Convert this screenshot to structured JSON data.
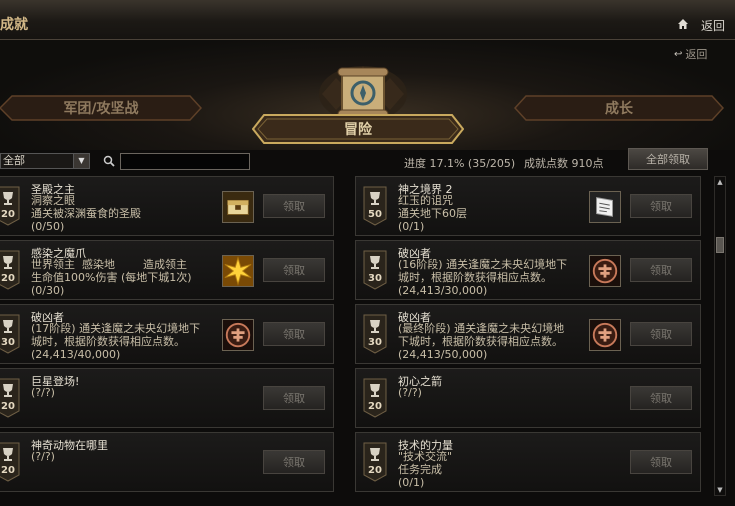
{
  "window": {
    "title": "成就",
    "back_top": "返回",
    "back_sub": "返回"
  },
  "tabs": {
    "left": "军团/攻坚战",
    "active": "冒险",
    "right": "成长"
  },
  "toolbar": {
    "filter_value": "全部",
    "search_value": "",
    "progress": "进度  17.1% (35/205)",
    "points": "成就点数 910点",
    "claim_all": "全部领取"
  },
  "achievements": [
    {
      "name": "圣殿之主",
      "desc": "洞察之眼\n通关被深渊蚕食的圣殿\n(0/50)",
      "points": "20",
      "reward": "chest-icon"
    },
    {
      "name": "神之境界 2",
      "desc": "红玉的诅咒\n通关地下60层\n(0/1)",
      "points": "50",
      "reward": "scroll-icon"
    },
    {
      "name": "感染之魔爪",
      "desc": "世界领主  感染地        造成领主\n生命值100%伤害 (每地下城1次)\n(0/30)",
      "points": "20",
      "reward": "burst-icon"
    },
    {
      "name": "破凶者",
      "desc": "(16阶段) 通关逢魔之未央幻境地下\n城时，根据阶数获得相应点数。\n(24,413/30,000)",
      "points": "30",
      "reward": "seal-icon"
    },
    {
      "name": "破凶者",
      "desc": "(17阶段) 通关逢魔之未央幻境地下\n城时，根据阶数获得相应点数。\n(24,413/40,000)",
      "points": "30",
      "reward": "seal-icon"
    },
    {
      "name": "破凶者",
      "desc": "(最终阶段) 通关逢魔之未央幻境地\n下城时，根据阶数获得相应点数。\n(24,413/50,000)",
      "points": "30",
      "reward": "seal-icon"
    },
    {
      "name": "巨星登场!",
      "desc": "(?/?)",
      "points": "20",
      "reward": ""
    },
    {
      "name": "初心之箭",
      "desc": "(?/?)",
      "points": "20",
      "reward": ""
    },
    {
      "name": "神奇动物在哪里",
      "desc": "(?/?)",
      "points": "20",
      "reward": ""
    },
    {
      "name": "技术的力量",
      "desc": "\"技术交流\"\n任务完成\n(0/1)",
      "points": "20",
      "reward": ""
    }
  ],
  "claim_label": "领取",
  "colors": {
    "gold": "#c9a95e",
    "panel": "#1c1b1a",
    "accent_text": "#d2b887"
  }
}
